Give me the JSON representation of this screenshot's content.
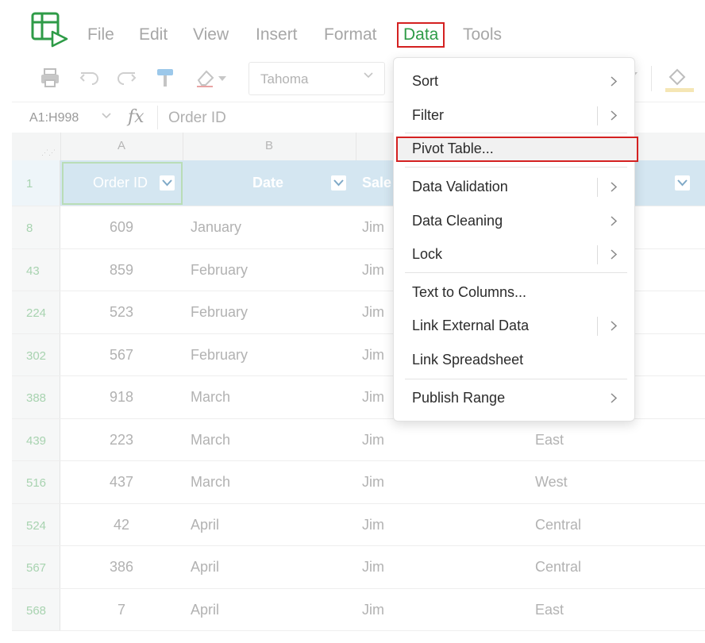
{
  "menubar": {
    "items": [
      {
        "label": "File",
        "active": false
      },
      {
        "label": "Edit",
        "active": false
      },
      {
        "label": "View",
        "active": false
      },
      {
        "label": "Insert",
        "active": false
      },
      {
        "label": "Format",
        "active": false
      },
      {
        "label": "Data",
        "active": true
      },
      {
        "label": "Tools",
        "active": false
      }
    ]
  },
  "toolbar": {
    "icons": [
      "print-icon",
      "undo-icon",
      "redo-icon",
      "paint-format-icon",
      "clear-format-icon",
      "fill-color-icon"
    ],
    "font_name": "Tahoma"
  },
  "formula_bar": {
    "cell_ref": "A1:H998",
    "fx_label": "fx",
    "content": "Order ID"
  },
  "columns": [
    "A",
    "B"
  ],
  "header_row": {
    "row_number": "1",
    "cells": [
      "Order ID",
      "Date",
      "Sale"
    ]
  },
  "rows": [
    {
      "row": "8",
      "order_id": "609",
      "date": "January",
      "rep": "Jim",
      "region": ""
    },
    {
      "row": "43",
      "order_id": "859",
      "date": "February",
      "rep": "Jim",
      "region": ""
    },
    {
      "row": "224",
      "order_id": "523",
      "date": "February",
      "rep": "Jim",
      "region": ""
    },
    {
      "row": "302",
      "order_id": "567",
      "date": "February",
      "rep": "Jim",
      "region": ""
    },
    {
      "row": "388",
      "order_id": "918",
      "date": "March",
      "rep": "Jim",
      "region": ""
    },
    {
      "row": "439",
      "order_id": "223",
      "date": "March",
      "rep": "Jim",
      "region": "East"
    },
    {
      "row": "516",
      "order_id": "437",
      "date": "March",
      "rep": "Jim",
      "region": "West"
    },
    {
      "row": "524",
      "order_id": "42",
      "date": "April",
      "rep": "Jim",
      "region": "Central"
    },
    {
      "row": "567",
      "order_id": "386",
      "date": "April",
      "rep": "Jim",
      "region": "Central"
    },
    {
      "row": "568",
      "order_id": "7",
      "date": "April",
      "rep": "Jim",
      "region": "East"
    }
  ],
  "data_menu": {
    "items": [
      {
        "label": "Sort",
        "submenu": true,
        "vsep": false
      },
      {
        "label": "Filter",
        "submenu": true,
        "vsep": true
      },
      {
        "label": "Pivot Table...",
        "submenu": false,
        "vsep": false,
        "highlighted": true
      },
      {
        "label": "Data Validation",
        "submenu": true,
        "vsep": true
      },
      {
        "label": "Data Cleaning",
        "submenu": true,
        "vsep": false
      },
      {
        "label": "Lock",
        "submenu": true,
        "vsep": true
      },
      {
        "label": "Text to Columns...",
        "submenu": false,
        "vsep": false
      },
      {
        "label": "Link External Data",
        "submenu": true,
        "vsep": true
      },
      {
        "label": "Link Spreadsheet",
        "submenu": false,
        "vsep": false
      },
      {
        "label": "Publish Range",
        "submenu": true,
        "vsep": false
      }
    ]
  },
  "colors": {
    "accent_green": "#2e9b47",
    "highlight_red": "#d42121",
    "header_fill": "#d4e6f1"
  }
}
